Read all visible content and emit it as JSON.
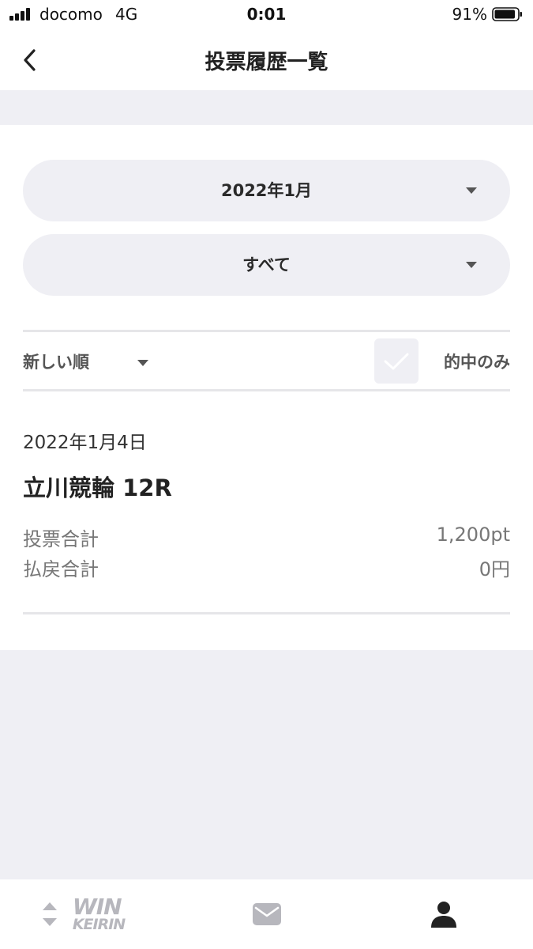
{
  "status_bar": {
    "carrier": "docomo",
    "network": "4G",
    "time": "0:01",
    "battery_percent": "91%",
    "battery_level": 0.91
  },
  "nav": {
    "title": "投票履歴一覧",
    "back_icon": "chevron-left-icon"
  },
  "filters": {
    "month": {
      "value": "2022年1月",
      "icon": "caret-down-icon"
    },
    "category": {
      "value": "すべて",
      "icon": "caret-down-icon"
    },
    "sort": {
      "value": "新しい順",
      "icon": "caret-down-icon"
    },
    "hit_only": {
      "label": "的中のみ",
      "checked": false
    }
  },
  "history": [
    {
      "date": "2022年1月4日",
      "race": "立川競輪 12R",
      "rows": [
        {
          "label": "投票合計",
          "value": "1,200pt"
        },
        {
          "label": "払戻合計",
          "value": "0円"
        }
      ]
    }
  ],
  "tab_bar": {
    "logo": {
      "line1": "WIN",
      "line2": "KEIRIN"
    },
    "items": [
      "sort-arrows-icon",
      "mail-icon",
      "person-icon"
    ]
  },
  "colors": {
    "background_gray": "#efeff4",
    "text_dark": "#2a2a2a",
    "text_muted": "#777777",
    "icon_gray": "#b7b7bd"
  }
}
